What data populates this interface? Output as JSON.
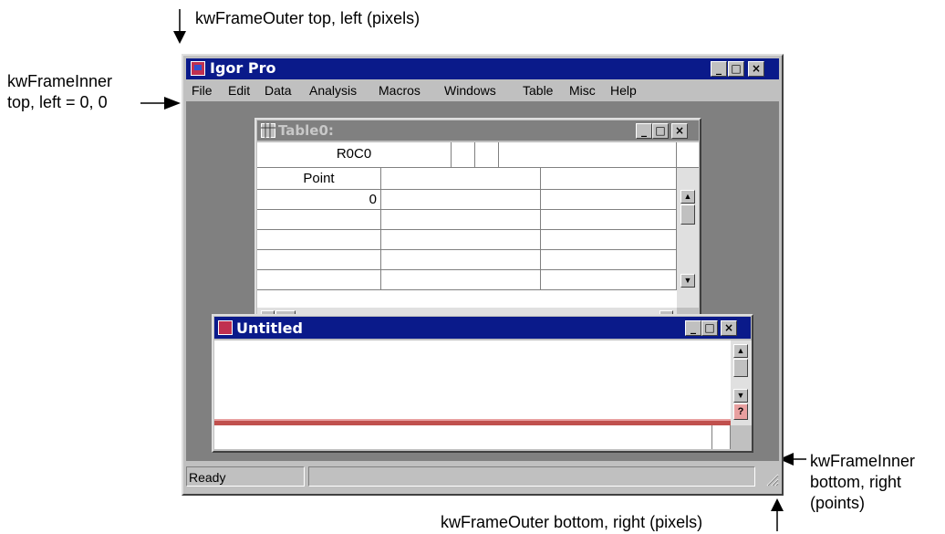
{
  "annotations": {
    "outer_top_left": "kwFrameOuter top, left (pixels)",
    "inner_top_left_line1": "kwFrameInner",
    "inner_top_left_line2": "top, left = 0, 0",
    "inner_bottom_right_line1": "kwFrameInner",
    "inner_bottom_right_line2": "bottom, right",
    "inner_bottom_right_line3": "(points)",
    "outer_bottom_right": "kwFrameOuter bottom, right (pixels)"
  },
  "app": {
    "title": "Igor Pro",
    "menu": [
      "File",
      "Edit",
      "Data",
      "Analysis",
      "Macros",
      "Windows",
      "Table",
      "Misc",
      "Help"
    ],
    "status": "Ready"
  },
  "table_window": {
    "title": "Table0:",
    "cell_ref": "R0C0",
    "header": "Point",
    "row0": "0"
  },
  "untitled_window": {
    "title": "Untitled"
  },
  "colors": {
    "titlebar_active": "#0a1a8a",
    "titlebar_inactive": "#808080",
    "workspace": "#808080",
    "chrome": "#c0c0c0",
    "divider_line": "#c0504d"
  },
  "icons": {
    "minimize": "minimize-icon",
    "maximize": "maximize-icon",
    "close": "close-icon",
    "arrow": "arrow-icon"
  },
  "glyphs": {
    "minimize": "_",
    "maximize": "□",
    "close": "×",
    "up": "▲",
    "down": "▼",
    "left": "◀",
    "right": "▶",
    "help": "?"
  }
}
